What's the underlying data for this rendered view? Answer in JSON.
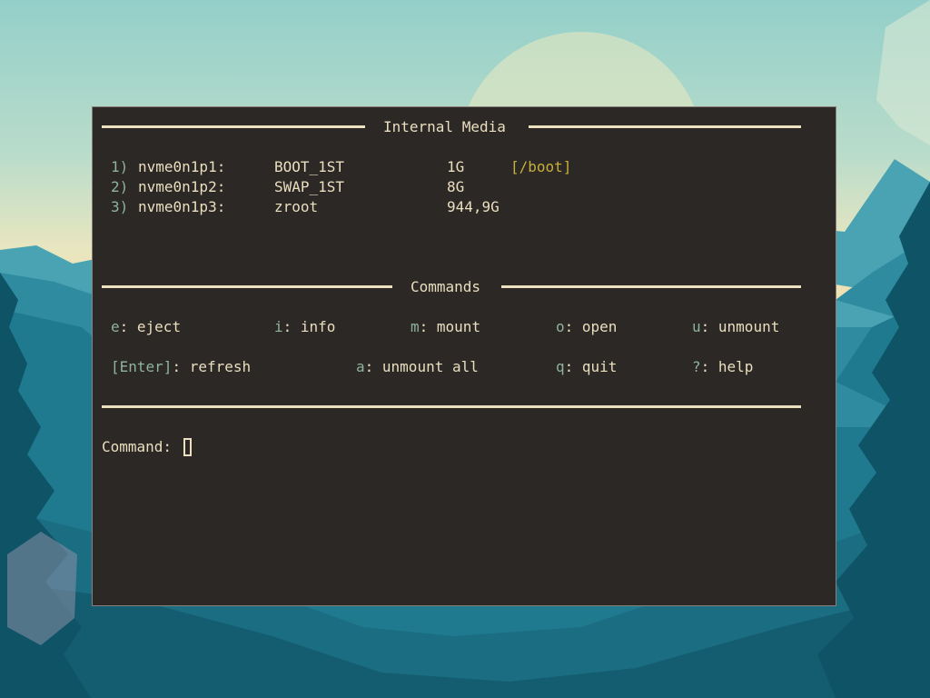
{
  "colors": {
    "terminal_bg": "#2b2826",
    "text": "#ebdfbf",
    "key_accent": "#8fb39c",
    "mountpoint": "#c6b03a"
  },
  "sections": {
    "media_title": "Internal Media",
    "commands_title": "Commands"
  },
  "devices": [
    {
      "index": "1)",
      "name": "nvme0n1p1:",
      "label": "BOOT_1ST",
      "size": "1G",
      "mountpoint": "[/boot]"
    },
    {
      "index": "2)",
      "name": "nvme0n1p2:",
      "label": "SWAP_1ST",
      "size": "8G",
      "mountpoint": ""
    },
    {
      "index": "3)",
      "name": "nvme0n1p3:",
      "label": "zroot",
      "size": "944,9G",
      "mountpoint": ""
    }
  ],
  "commands": {
    "eject": {
      "key": "e",
      "label": ": eject"
    },
    "info": {
      "key": "i",
      "label": ": info"
    },
    "mount": {
      "key": "m",
      "label": ": mount"
    },
    "open": {
      "key": "o",
      "label": ": open"
    },
    "unmount": {
      "key": "u",
      "label": ": unmount"
    },
    "refresh": {
      "key": "[Enter]",
      "label": ": refresh"
    },
    "unmount_all": {
      "key": "a",
      "label": ": unmount all"
    },
    "quit": {
      "key": "q",
      "label": ": quit"
    },
    "help": {
      "key": "?",
      "label": ": help"
    }
  },
  "prompt": {
    "label": "Command:",
    "value": ""
  },
  "wallpaper": {
    "icon": "forest-mountain-landscape"
  }
}
